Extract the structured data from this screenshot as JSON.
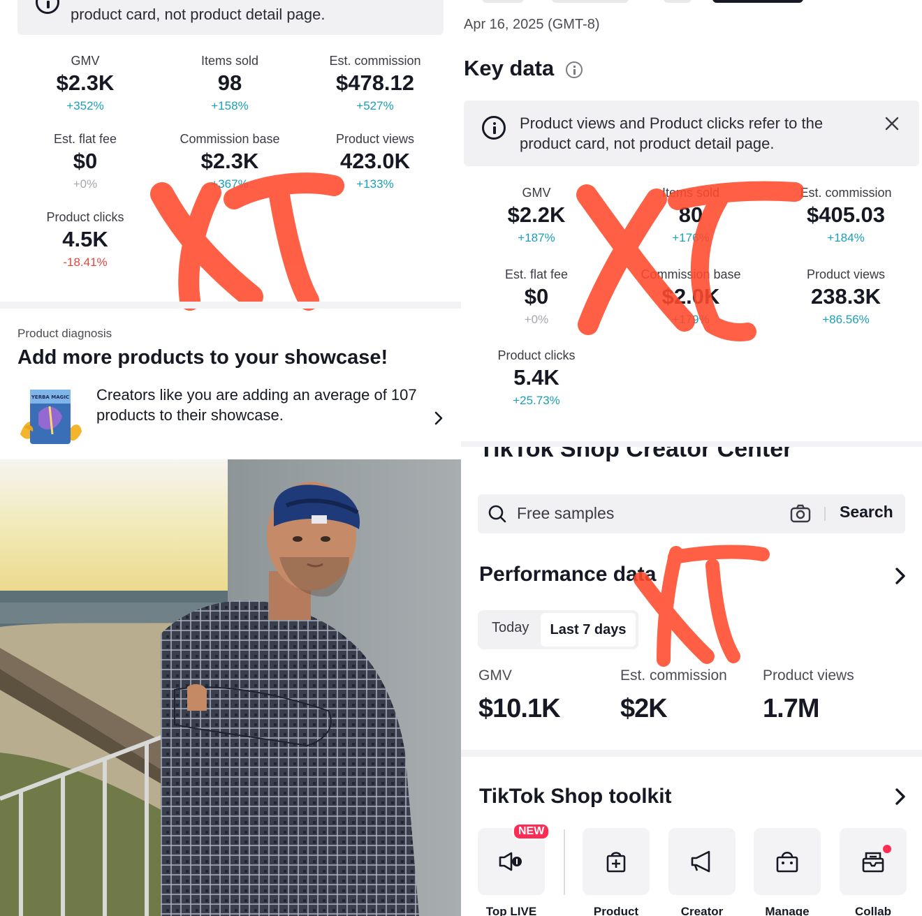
{
  "top_left": {
    "notice_text": "product card, not product detail page.",
    "metrics": [
      {
        "label": "GMV",
        "value": "$2.3K",
        "change": "+352%",
        "trend": "up"
      },
      {
        "label": "Items sold",
        "value": "98",
        "change": "+158%",
        "trend": "up"
      },
      {
        "label": "Est. commission",
        "value": "$478.12",
        "change": "+527%",
        "trend": "up"
      },
      {
        "label": "Est. flat fee",
        "value": "$0",
        "change": "+0%",
        "trend": "flat"
      },
      {
        "label": "Commission base",
        "value": "$2.3K",
        "change": "+367%",
        "trend": "up"
      },
      {
        "label": "Product views",
        "value": "423.0K",
        "change": "+133%",
        "trend": "up"
      },
      {
        "label": "Product clicks",
        "value": "4.5K",
        "change": "-18.41%",
        "trend": "down"
      }
    ],
    "diagnosis": {
      "caption": "Product diagnosis",
      "headline": "Add more products to your showcase!",
      "text": "Creators like you are adding an average of 107 products to their showcase.",
      "thumb_text": "YERBA MAGIC"
    }
  },
  "top_right": {
    "date": "Apr 16, 2025 (GMT-8)",
    "key_title": "Key data",
    "notice_text": "Product views and Product clicks refer to the product card, not product detail page.",
    "metrics": [
      {
        "label": "GMV",
        "value": "$2.2K",
        "change": "+187%",
        "trend": "up"
      },
      {
        "label": "Items sold",
        "value": "80",
        "change": "+176%",
        "trend": "up"
      },
      {
        "label": "Est. commission",
        "value": "$405.03",
        "change": "+184%",
        "trend": "up"
      },
      {
        "label": "Est. flat fee",
        "value": "$0",
        "change": "+0%",
        "trend": "flat"
      },
      {
        "label": "Commission base",
        "value": "$2.0K",
        "change": "+179%",
        "trend": "up"
      },
      {
        "label": "Product views",
        "value": "238.3K",
        "change": "+86.56%",
        "trend": "up"
      },
      {
        "label": "Product clicks",
        "value": "5.4K",
        "change": "+25.73%",
        "trend": "up"
      }
    ]
  },
  "bottom_right": {
    "app_title": "TikTok Shop Creator Center",
    "search_placeholder": "Free samples",
    "search_button": "Search",
    "performance_title": "Performance data",
    "tabs": [
      "Today",
      "Last 7 days"
    ],
    "selected_tab": "Last 7 days",
    "metrics": [
      {
        "label": "GMV",
        "value": "$10.1K"
      },
      {
        "label": "Est. commission",
        "value": "$2K"
      },
      {
        "label": "Product views",
        "value": "1.7M"
      }
    ],
    "toolkit_title": "TikTok Shop toolkit",
    "new_badge": "NEW",
    "tools": [
      {
        "label": "Top LIVE",
        "icon": "live-icon"
      },
      {
        "label": "Product",
        "icon": "product-bag-plus-icon"
      },
      {
        "label": "Creator",
        "icon": "megaphone-icon"
      },
      {
        "label": "Manage",
        "icon": "shopping-bag-icon"
      },
      {
        "label": "Collab",
        "icon": "collab-inbox-icon"
      }
    ]
  },
  "colors": {
    "positive": "#1a9fb6",
    "negative": "#e0483c",
    "neutral": "#a6a7ad",
    "scribble": "#ff4a2c",
    "badge": "#fe2c55"
  }
}
